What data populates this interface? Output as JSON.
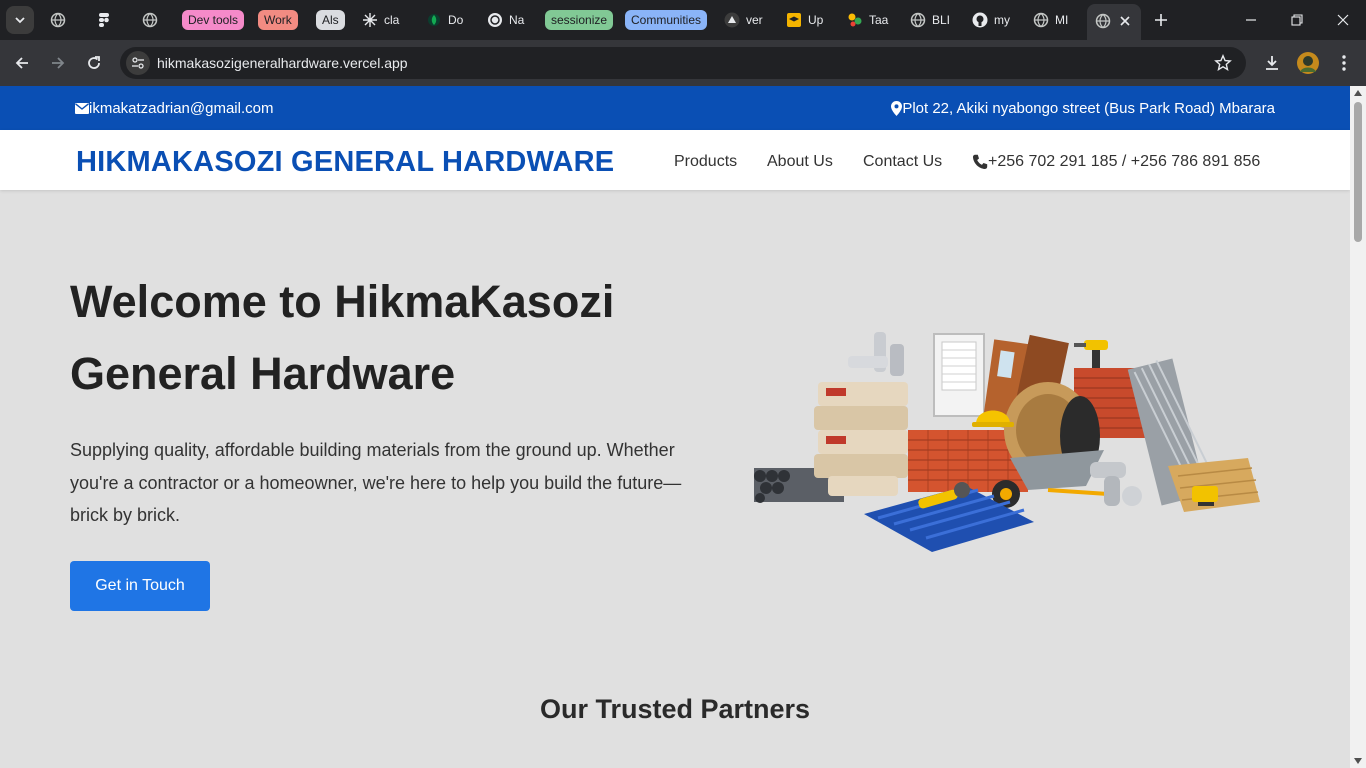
{
  "browser": {
    "tabs": [
      {
        "label": "",
        "icon": "globe-icon"
      },
      {
        "label": "",
        "icon": "figma-icon"
      },
      {
        "label": "",
        "icon": "globe-icon"
      },
      {
        "label": "cla",
        "icon": "sparkle-icon"
      },
      {
        "label": "Do",
        "icon": "leaf-icon"
      },
      {
        "label": "Na",
        "icon": "openai-icon"
      },
      {
        "label": "ver",
        "icon": "triangle-icon"
      },
      {
        "label": "Up",
        "icon": "graduation-icon"
      },
      {
        "label": "Taa",
        "icon": "dots-icon"
      },
      {
        "label": "BLI",
        "icon": "globe-icon"
      },
      {
        "label": "my",
        "icon": "github-icon"
      },
      {
        "label": "MI",
        "icon": "globe-icon"
      }
    ],
    "tab_groups": [
      {
        "label": "Dev tools",
        "color": "#f58ac9"
      },
      {
        "label": "Work",
        "color": "#f28b82"
      },
      {
        "label": "Als",
        "color": "#dadce0"
      },
      {
        "label": "sessionize",
        "color": "#81c995"
      },
      {
        "label": "Communities",
        "color": "#8ab4f8"
      }
    ],
    "url": "hikmakasozigeneralhardware.vercel.app"
  },
  "page": {
    "topbar": {
      "email": "ikmakatzadrian@gmail.com",
      "address": "Plot 22, Akiki nyabongo street (Bus Park Road) Mbarara",
      "bg_color": "#0a4fb4"
    },
    "header": {
      "brand": "HIKMAKASOZI GENERAL HARDWARE",
      "nav": [
        "Products",
        "About Us",
        "Contact Us"
      ],
      "phone": "+256 702 291 185 / +256 786 891 856",
      "brand_color": "#0a4fb4"
    },
    "hero": {
      "title_line1": "Welcome to HikmaKasozi",
      "title_line2": "General Hardware",
      "text": "Supplying quality, affordable building materials from the ground up. Whether you're a contractor or a homeowner, we're here to help you build the future—brick by brick.",
      "cta": "Get in Touch",
      "cta_color": "#1f75e5"
    },
    "partners_heading": "Our Trusted Partners"
  }
}
